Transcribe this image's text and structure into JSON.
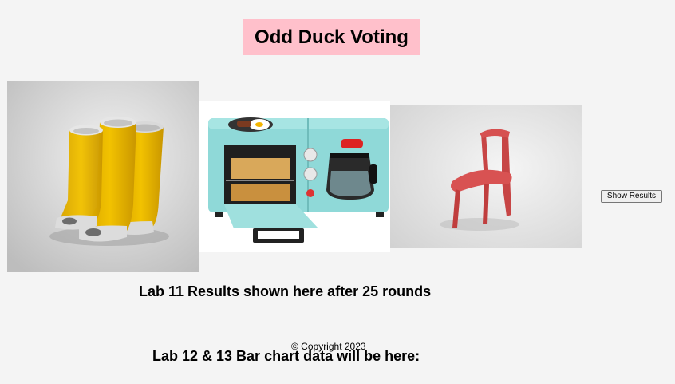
{
  "header": {
    "title": "Odd Duck Voting"
  },
  "products": [
    {
      "name": "boots-image",
      "description": "yellow open-toe rain boots"
    },
    {
      "name": "breakfast-image",
      "description": "aqua 3-in-1 breakfast station"
    },
    {
      "name": "chair-image",
      "description": "red chair with upward-curving seat"
    }
  ],
  "controls": {
    "show_results_label": "Show Results"
  },
  "main": {
    "lab11_heading": "Lab 11 Results shown here after 25 rounds",
    "lab12_heading": "Lab 12 & 13 Bar chart data will be here:"
  },
  "footer": {
    "copyright": "© Copyright 2023"
  },
  "colors": {
    "title_background": "#ffc0cb",
    "page_background": "#f4f4f4"
  }
}
